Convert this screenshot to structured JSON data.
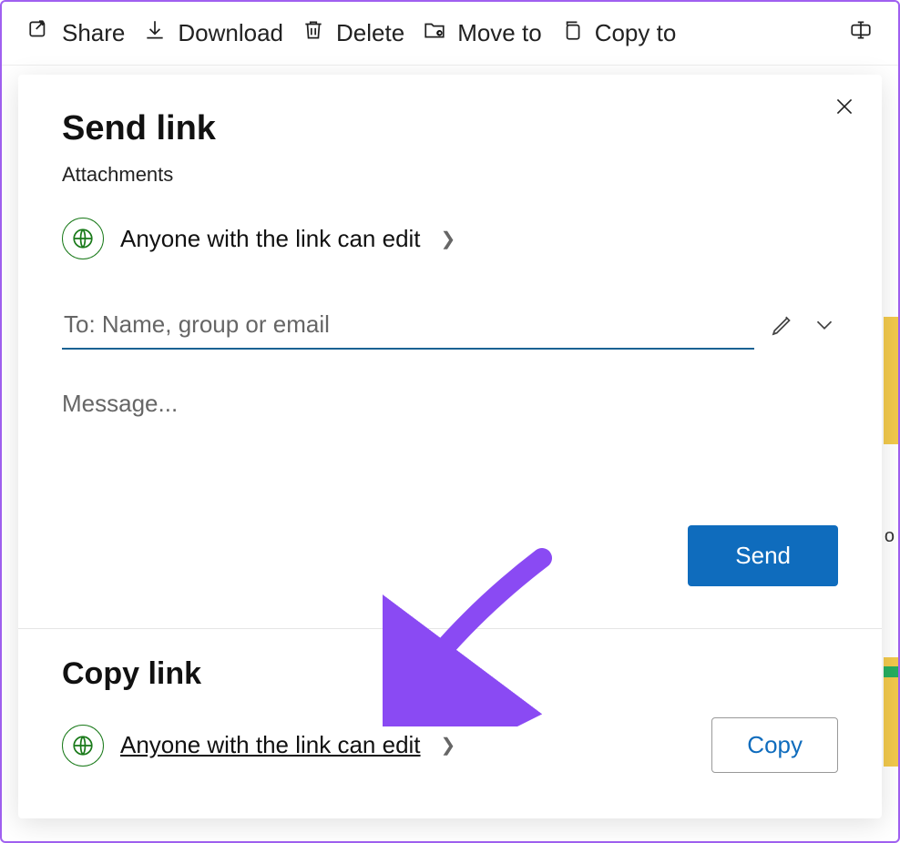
{
  "toolbar": {
    "share": "Share",
    "download": "Download",
    "delete": "Delete",
    "moveto": "Move to",
    "copyto": "Copy to"
  },
  "dialog": {
    "title": "Send link",
    "subtitle": "Attachments",
    "permission_text": "Anyone with the link can edit",
    "to_placeholder": "To: Name, group or email",
    "message_placeholder": "Message...",
    "send_label": "Send",
    "copy_section_title": "Copy link",
    "copy_permission_text": "Anyone with the link can edit",
    "copy_label": "Copy"
  },
  "stray_char": "o"
}
